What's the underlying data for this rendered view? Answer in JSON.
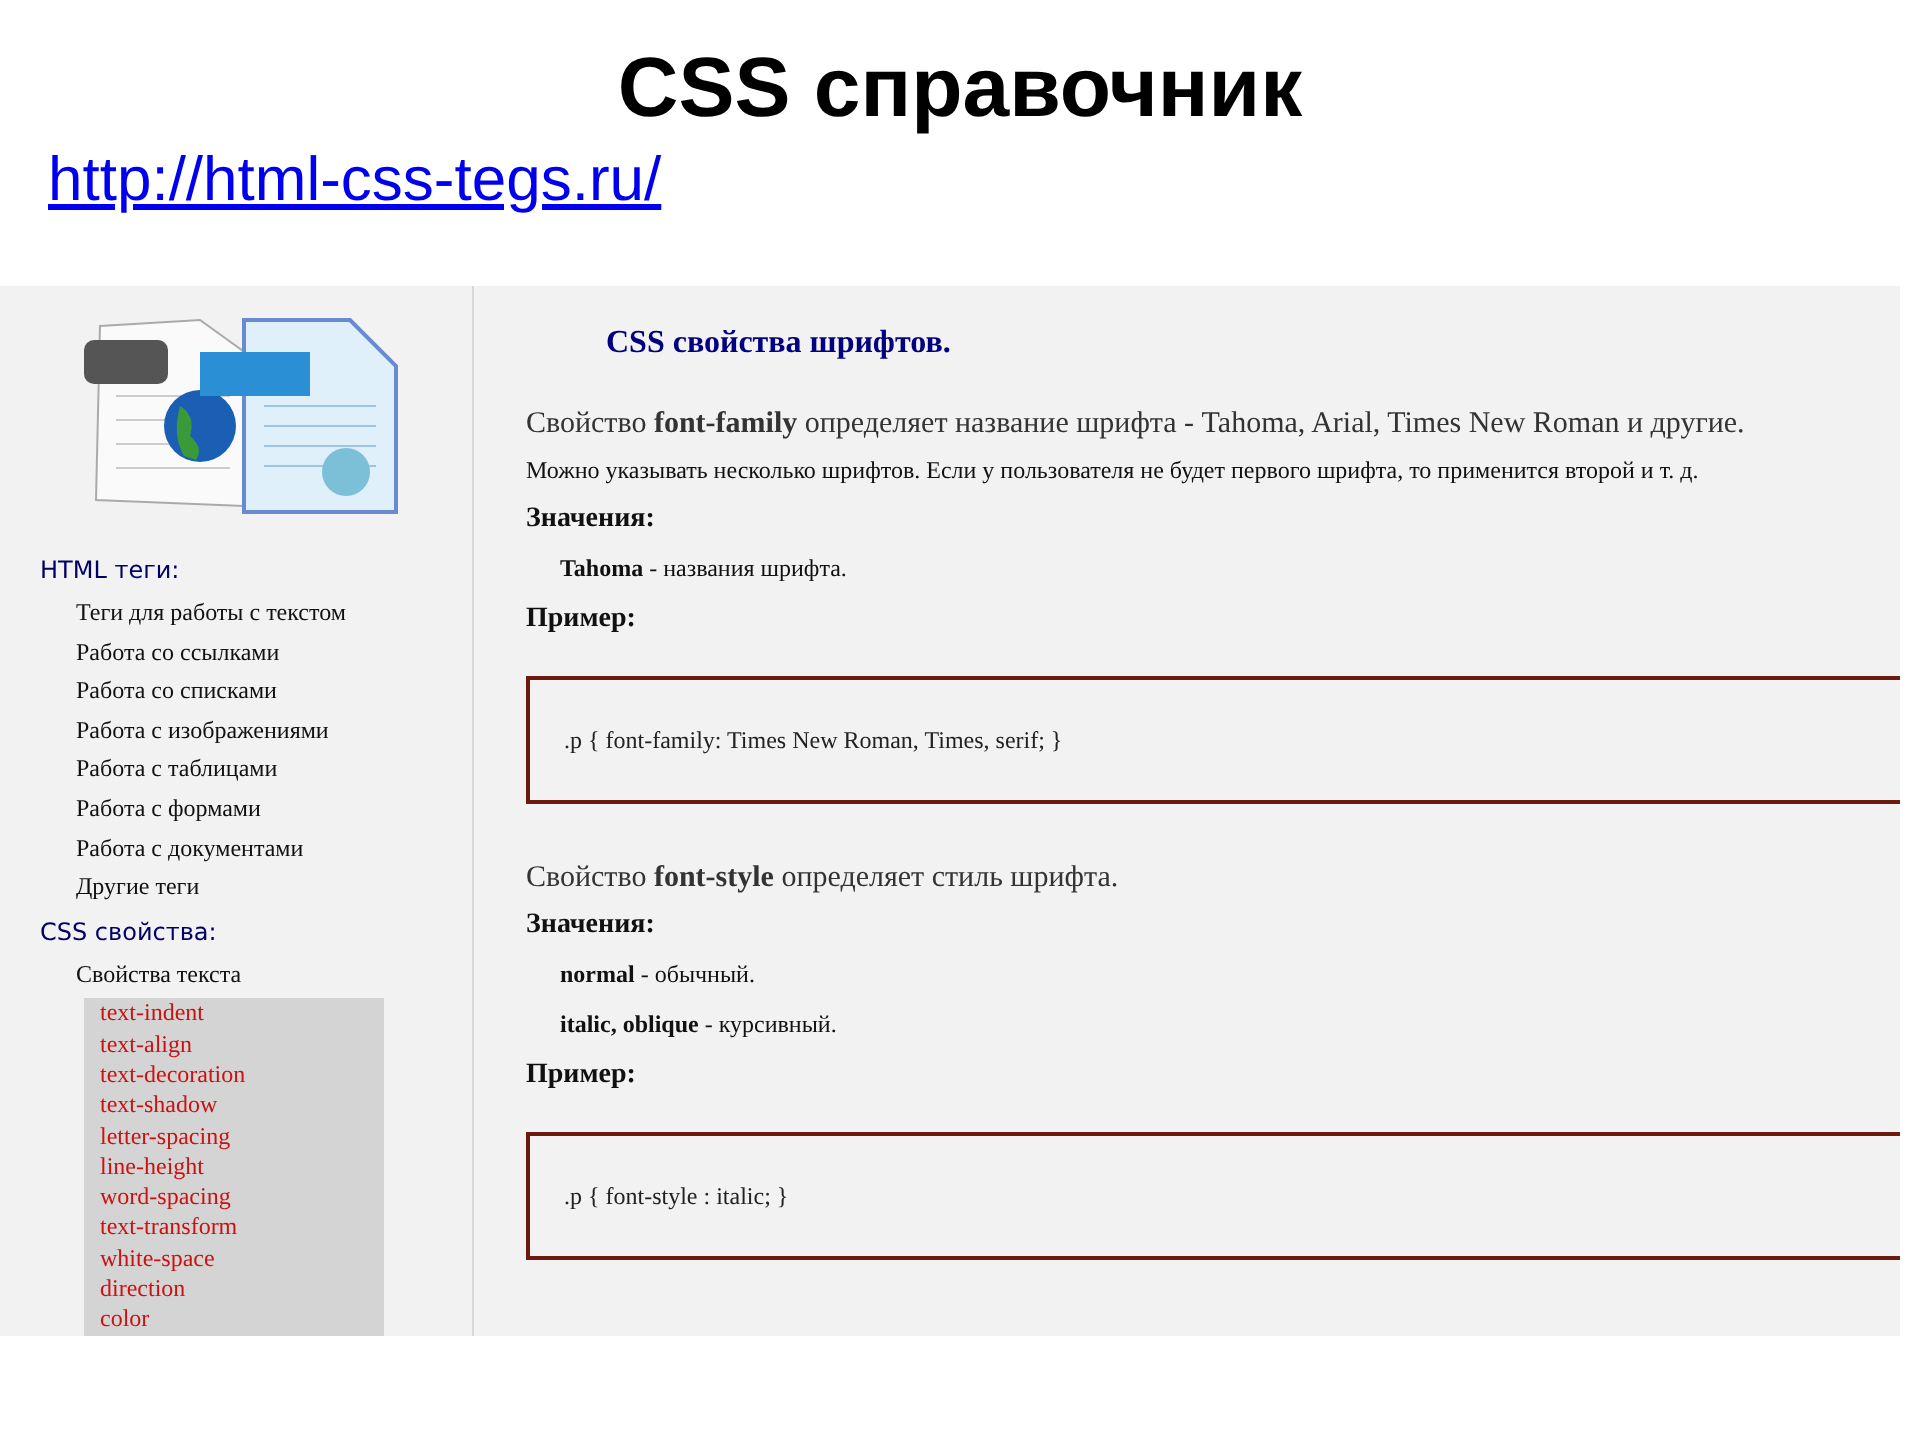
{
  "slide": {
    "title": "CSS справочник",
    "link": "http://html-css-tegs.ru/"
  },
  "sidebar": {
    "sections": [
      {
        "heading": "HTML теги:",
        "items": [
          {
            "label": "Теги для работы с текстом"
          },
          {
            "label": "Работа со ссылками"
          },
          {
            "label": "Работа со списками"
          },
          {
            "label": "Работа с изображениями"
          },
          {
            "label": "Работа с таблицами"
          },
          {
            "label": "Работа с формами"
          },
          {
            "label": "Работа с документами"
          },
          {
            "label": "Другие теги"
          }
        ]
      },
      {
        "heading": "CSS свойства:",
        "items": [
          {
            "label": "Свойства текста",
            "expanded": true,
            "children": [
              {
                "label": "text-indent"
              },
              {
                "label": "text-align"
              },
              {
                "label": "text-decoration"
              },
              {
                "label": "text-shadow"
              },
              {
                "label": "letter-spacing"
              },
              {
                "label": "line-height"
              },
              {
                "label": "word-spacing"
              },
              {
                "label": "text-transform"
              },
              {
                "label": "white-space"
              },
              {
                "label": "direction"
              },
              {
                "label": "color"
              }
            ]
          }
        ]
      }
    ]
  },
  "content": {
    "heading": "CSS свойства шрифтов.",
    "blocks": [
      {
        "kind": "lead",
        "text": "Свойство **font-family** определяет название шрифта - Tahoma, Arial, Times New Roman и другие."
      },
      {
        "kind": "note",
        "text": "Можно указывать несколько шрифтов. Если у пользователя не будет первого шрифта, то применится второй и т. д."
      },
      {
        "kind": "label",
        "text": "Значения:"
      },
      {
        "kind": "value",
        "text": "**Tahoma** - названия шрифта."
      },
      {
        "kind": "label",
        "text": "Пример:"
      },
      {
        "kind": "code",
        "text": ".p { font-family: Times New Roman, Times, serif; }"
      },
      {
        "kind": "lead",
        "text": "Свойство **font-style** определяет стиль шрифта."
      },
      {
        "kind": "label",
        "text": "Значения:"
      },
      {
        "kind": "value",
        "text": "**normal** - обычный."
      },
      {
        "kind": "value",
        "text": "**italic, oblique** - курсивный."
      },
      {
        "kind": "label",
        "text": "Пример:"
      },
      {
        "kind": "code",
        "text": ".p { font-style : italic; }"
      }
    ]
  }
}
